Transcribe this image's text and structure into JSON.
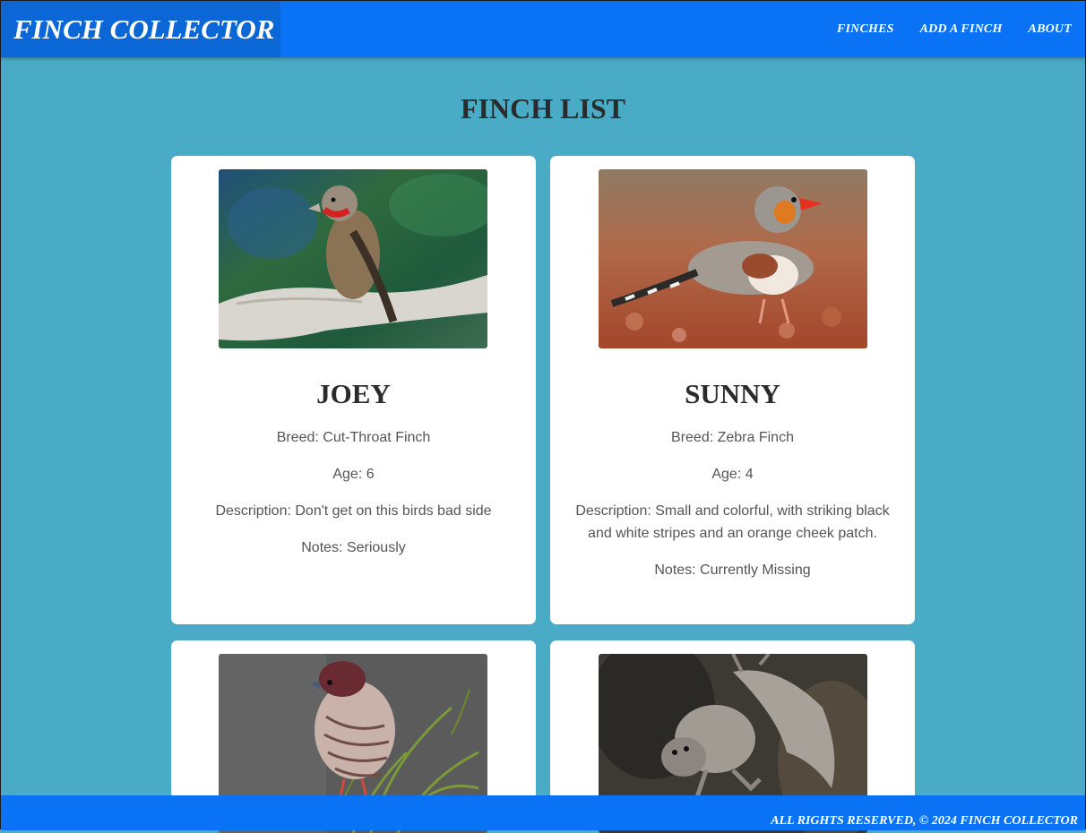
{
  "nav": {
    "brand": "FINCH COLLECTOR",
    "links": [
      "FINCHES",
      "ADD A FINCH",
      "ABOUT"
    ]
  },
  "page": {
    "title": "FINCH LIST"
  },
  "finches": [
    {
      "name": "JOEY",
      "breed": "Breed: Cut-Throat Finch",
      "age": "Age: 6",
      "description": "Description: Don't get on this birds bad side",
      "notes": "Notes: Seriously"
    },
    {
      "name": "SUNNY",
      "breed": "Breed: Zebra Finch",
      "age": "Age: 4",
      "description": "Description: Small and colorful, with striking black and white stripes and an orange cheek patch.",
      "notes": "Notes: Currently Missing"
    }
  ],
  "footer": {
    "text": "ALL RIGHTS RESERVED, © 2024 FINCH COLLECTOR"
  }
}
